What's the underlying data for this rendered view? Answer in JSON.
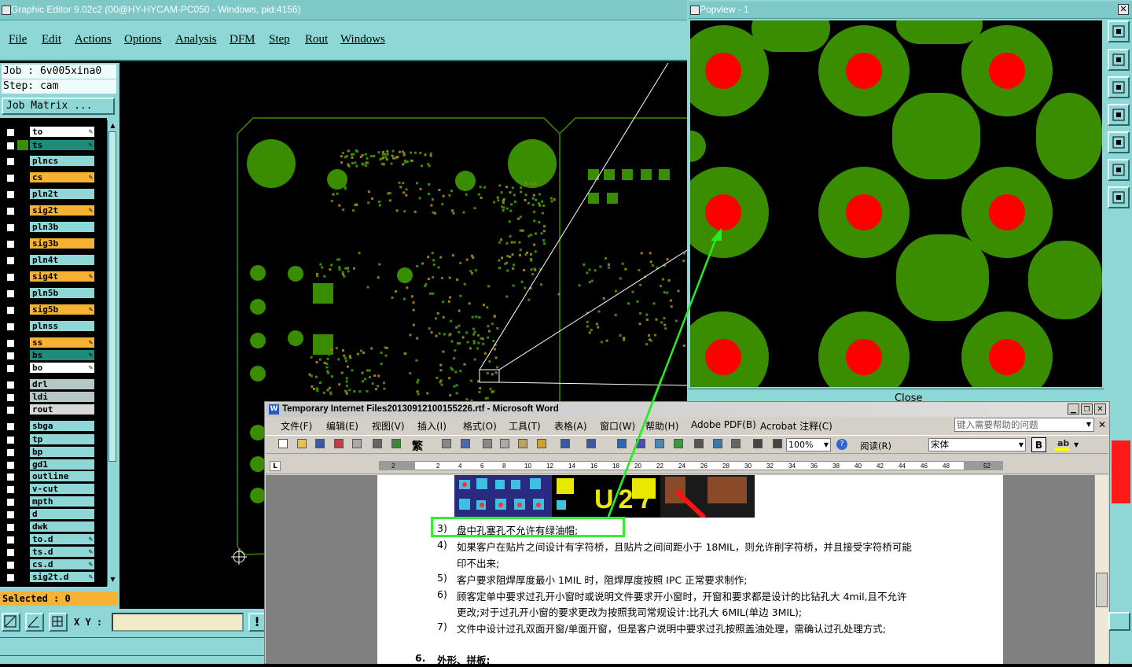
{
  "editor": {
    "title": "Graphic Editor 9.02c2 (00@HY-HYCAM-PC050 - Windows, pid:4156)",
    "menu": [
      "File",
      "Edit",
      "Actions",
      "Options",
      "Analysis",
      "DFM",
      "Step",
      "Rout",
      "Windows"
    ],
    "job": "Job : 6v005xina0",
    "step": "Step: cam",
    "job_matrix": "Job Matrix ...",
    "layers": [
      {
        "name": "to",
        "color": "#ffffff",
        "pen": true
      },
      {
        "name": "ts",
        "color": "#1e8c7a",
        "pen": true
      },
      {
        "name": "plncs",
        "color": "#8fd7d7",
        "pen": false
      },
      {
        "name": "cs",
        "color": "#f5b233",
        "pen": true
      },
      {
        "name": "pln2t",
        "color": "#8fd7d7",
        "pen": false
      },
      {
        "name": "sig2t",
        "color": "#f5b233",
        "pen": true
      },
      {
        "name": "pln3b",
        "color": "#8fd7d7",
        "pen": false
      },
      {
        "name": "sig3b",
        "color": "#f5b233",
        "pen": false
      },
      {
        "name": "pln4t",
        "color": "#8fd7d7",
        "pen": false
      },
      {
        "name": "sig4t",
        "color": "#f5b233",
        "pen": true
      },
      {
        "name": "pln5b",
        "color": "#8fd7d7",
        "pen": false
      },
      {
        "name": "sig5b",
        "color": "#f5b233",
        "pen": true
      },
      {
        "name": "plnss",
        "color": "#8fd7d7",
        "pen": false
      },
      {
        "name": "ss",
        "color": "#f5b233",
        "pen": true
      },
      {
        "name": "bs",
        "color": "#1e8c7a",
        "pen": true
      },
      {
        "name": "bo",
        "color": "#ffffff",
        "pen": true
      },
      {
        "name": "drl",
        "color": "#b7c7c7",
        "pen": false
      },
      {
        "name": "ldi",
        "color": "#b7c7c7",
        "pen": false
      },
      {
        "name": "rout",
        "color": "#d8d8d8",
        "pen": false
      },
      {
        "name": "sbga",
        "color": "#8fd7d7",
        "pen": false
      },
      {
        "name": "tp",
        "color": "#8fd7d7",
        "pen": false
      },
      {
        "name": "bp",
        "color": "#8fd7d7",
        "pen": false
      },
      {
        "name": "gd1",
        "color": "#8fd7d7",
        "pen": false
      },
      {
        "name": "outline",
        "color": "#8fd7d7",
        "pen": false
      },
      {
        "name": "v-cut",
        "color": "#8fd7d7",
        "pen": false
      },
      {
        "name": "mpth",
        "color": "#8fd7d7",
        "pen": false
      },
      {
        "name": "d",
        "color": "#8fd7d7",
        "pen": false
      },
      {
        "name": "dwk",
        "color": "#8fd7d7",
        "pen": false
      },
      {
        "name": "to.d",
        "color": "#8fd7d7",
        "pen": true
      },
      {
        "name": "ts.d",
        "color": "#8fd7d7",
        "pen": true
      },
      {
        "name": "cs.d",
        "color": "#8fd7d7",
        "pen": true
      },
      {
        "name": "sig2t.d",
        "color": "#8fd7d7",
        "pen": true
      }
    ],
    "selected": "Selected : 0",
    "xy_label": "X Y :",
    "xy_value": "",
    "colors": {
      "teal": "#8fd7d7",
      "board_green": "#3a8c00",
      "pad_red": "#ff0000",
      "highlight_green": "#33ff33"
    }
  },
  "popview": {
    "title": "Popview - 1",
    "bottom_label": "Close"
  },
  "word": {
    "title": "Temporary Internet Files20130912100155226.rtf - Microsoft Word",
    "menu": [
      "文件(F)",
      "编辑(E)",
      "视图(V)",
      "插入(I)",
      "格式(O)",
      "工具(T)",
      "表格(A)",
      "窗口(W)",
      "帮助(H)",
      "Adobe PDF(B)",
      "Acrobat 注释(C)"
    ],
    "help_placeholder": "键入需要帮助的问题",
    "zoom": "100%",
    "read_label": "阅读(R)",
    "font_name": "宋体",
    "bold_label": "B",
    "trad_label": "繁",
    "ruler_marks": [
      "2",
      "2",
      "4",
      "6",
      "8",
      "10",
      "12",
      "14",
      "16",
      "18",
      "20",
      "22",
      "24",
      "26",
      "28",
      "30",
      "32",
      "34",
      "36",
      "38",
      "40",
      "42",
      "44",
      "46",
      "48",
      "52"
    ],
    "image_text": "U27",
    "paragraphs": [
      {
        "num": "3)",
        "text": "盘中孔塞孔不允许有绿油帽;"
      },
      {
        "num": "4)",
        "text": "如果客户在贴片之间设计有字符桥，且贴片之间间距小于 18MIL，则允许削字符桥，并且接受字符桥可能"
      },
      {
        "num": "",
        "text": "印不出来;"
      },
      {
        "num": "5)",
        "text": "客户要求阻焊厚度最小 1MIL 时，阻焊厚度按照 IPC 正常要求制作;"
      },
      {
        "num": "6)",
        "text": "顾客定单中要求过孔开小窗时或说明文件要求开小窗时，开窗和要求都是设计的比钻孔大 4mil,且不允许"
      },
      {
        "num": "",
        "text": "更改;对于过孔开小窗的要求更改为按照我司常规设计:比孔大 6MIL(单边 3MIL);"
      },
      {
        "num": "7)",
        "text": "文件中设计过孔双面开窗/单面开窗，但是客户说明中要求过孔按照盖油处理，需确认过孔处理方式;"
      }
    ],
    "heading_num": "6.",
    "heading_text": "外形、拼板:",
    "ruler_tab": "L"
  }
}
